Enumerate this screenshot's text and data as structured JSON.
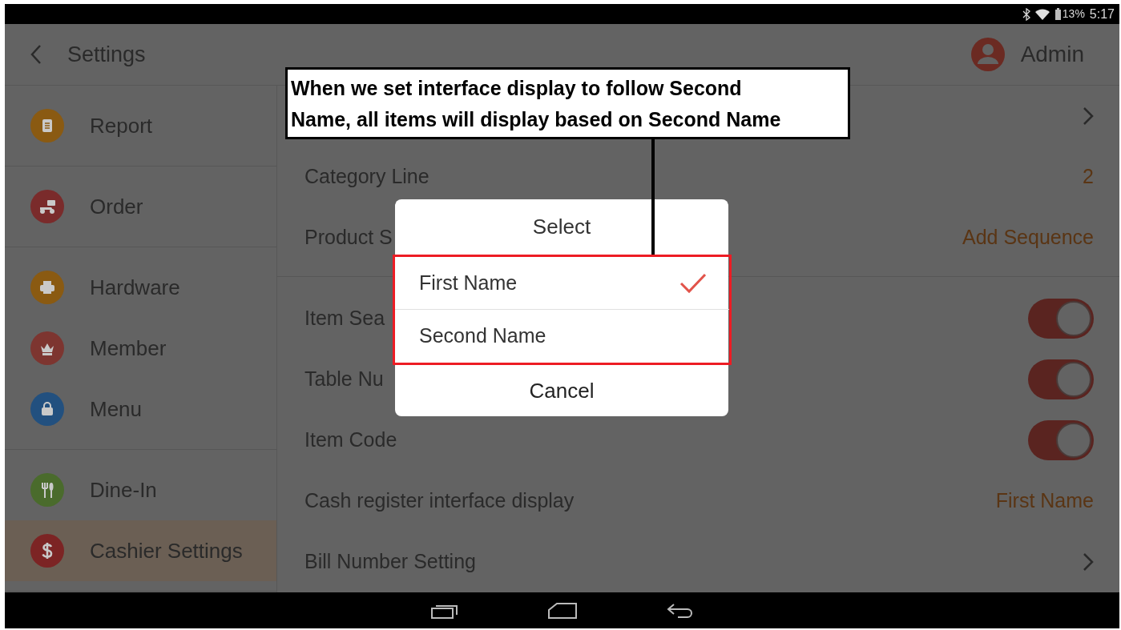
{
  "status_bar": {
    "battery": "13%",
    "time": "5:17"
  },
  "header": {
    "title": "Settings",
    "user": "Admin"
  },
  "sidebar": {
    "groups": [
      {
        "items": [
          {
            "kind": "report",
            "label": "Report",
            "color": "#8a5a12",
            "selected": false
          }
        ]
      },
      {
        "items": [
          {
            "kind": "order",
            "label": "Order",
            "color": "#7a2b2b",
            "selected": false
          }
        ]
      },
      {
        "items": [
          {
            "kind": "hardware",
            "label": "Hardware",
            "color": "#8a5a12",
            "selected": false
          },
          {
            "kind": "member",
            "label": "Member",
            "color": "#7d3530",
            "selected": false
          },
          {
            "kind": "menu",
            "label": "Menu",
            "color": "#22507f",
            "selected": false
          }
        ]
      },
      {
        "items": [
          {
            "kind": "dine",
            "label": "Dine-In",
            "color": "#4a6b2c",
            "selected": false
          },
          {
            "kind": "cashier",
            "label": "Cashier Settings",
            "color": "#7c2424",
            "selected": true
          }
        ]
      }
    ]
  },
  "settings": {
    "sections": [
      {
        "rows": [
          {
            "kind": "link"
          },
          {
            "kind": "value",
            "label": "Category Line",
            "value": "2"
          },
          {
            "kind": "value",
            "label": "Product S",
            "value": "Add Sequence"
          }
        ]
      },
      {
        "rows": [
          {
            "kind": "toggle",
            "label": "Item Sea",
            "on": true
          },
          {
            "kind": "toggle",
            "label": "Table Nu",
            "on": true
          },
          {
            "kind": "toggle",
            "label": "Item Code",
            "on": true
          },
          {
            "kind": "value",
            "label": "Cash register interface display",
            "value": "First Name"
          },
          {
            "kind": "link",
            "label": "Bill Number Setting"
          }
        ]
      }
    ]
  },
  "dialog": {
    "title": "Select",
    "options": [
      {
        "label": "First Name",
        "selected": true
      },
      {
        "label": "Second Name",
        "selected": false
      }
    ],
    "cancel": "Cancel"
  },
  "annotation": {
    "text": "When we set interface display to follow Second Name, all items will display based on Second Name"
  }
}
